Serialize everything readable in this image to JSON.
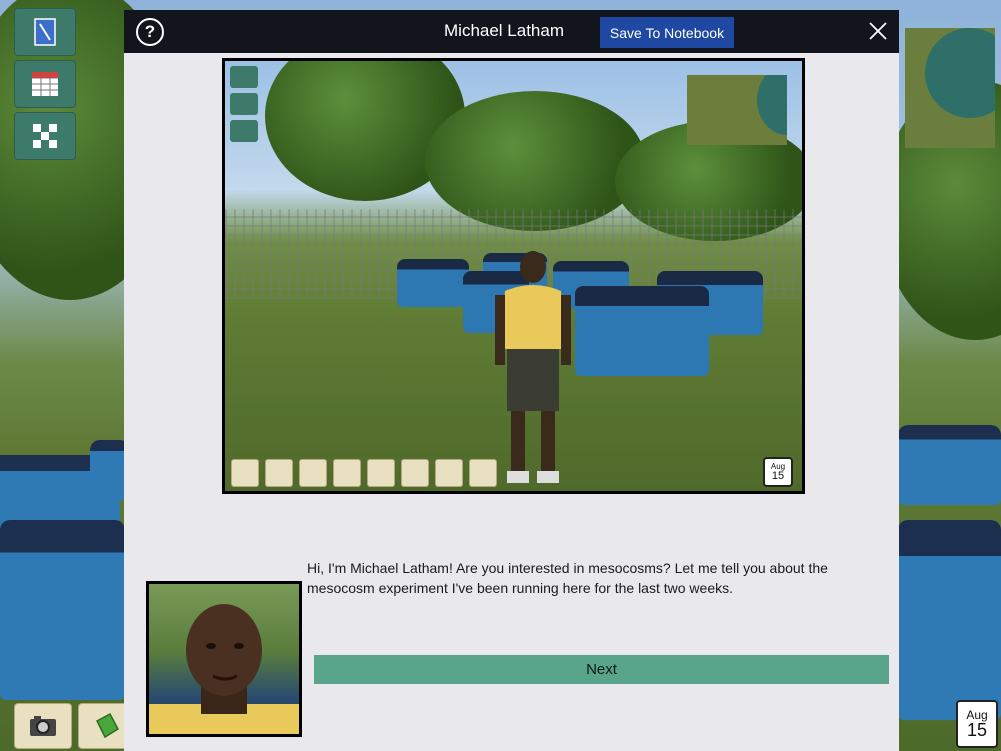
{
  "modal": {
    "title": "Michael Latham",
    "save_label": "Save To Notebook",
    "help_glyph": "?",
    "dialog_text": "Hi, I'm Michael Latham! Are you interested in mesocosms? Let me tell you about the mesocosm experiment I've been running here for the last two weeks.",
    "next_label": "Next"
  },
  "date": {
    "month": "Aug",
    "day": "15"
  },
  "preview": {
    "date_month": "Aug",
    "date_day": "15"
  },
  "icons": {
    "left_sidebar": [
      "notebook-icon",
      "data-table-icon",
      "map-grid-icon"
    ],
    "bottom_toolbar": [
      "camera-icon",
      "field-guide-icon"
    ],
    "preview_toolbar": [
      "camera-icon",
      "field-guide-icon",
      "tray-icon",
      "laptop-icon",
      "map-icon",
      "pipette-icon",
      "scale-icon",
      "probe-icon"
    ]
  },
  "colors": {
    "titlebar": "#13151d",
    "save_button": "#1e48a1",
    "next_button": "#58a58b",
    "modal_bg": "#e9e9ed"
  }
}
